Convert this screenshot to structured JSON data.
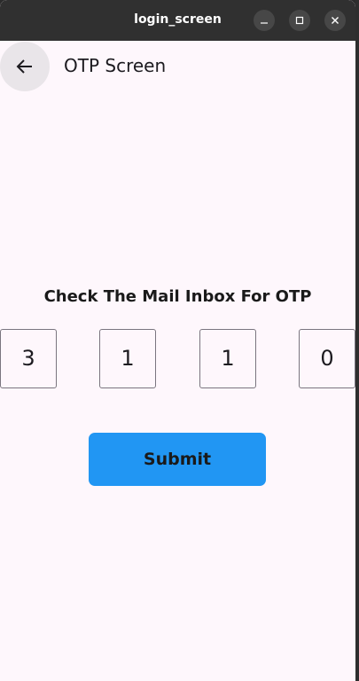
{
  "window": {
    "title": "login_screen"
  },
  "appbar": {
    "title": "OTP Screen"
  },
  "main": {
    "heading": "Check The Mail Inbox For OTP",
    "otp_digits": [
      "3",
      "1",
      "1",
      "0"
    ],
    "submit_label": "Submit"
  },
  "colors": {
    "background": "#fef7fc",
    "accent": "#2196f3",
    "titlebar": "#303030"
  },
  "icons": {
    "back": "arrow-left-icon",
    "minimize": "minimize-icon",
    "maximize": "maximize-icon",
    "close": "close-icon"
  }
}
